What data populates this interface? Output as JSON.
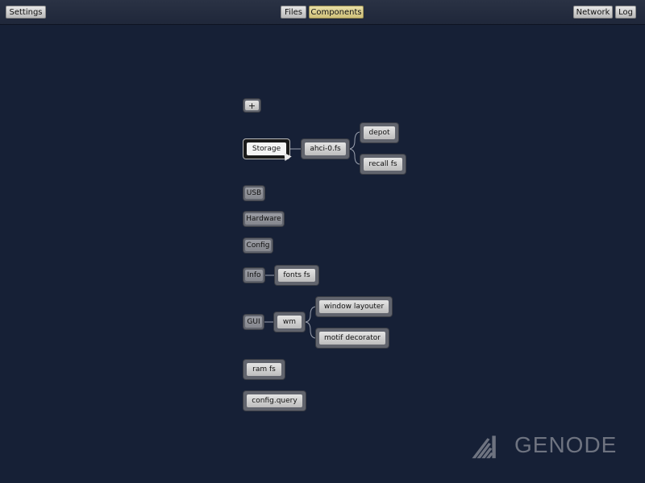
{
  "topbar": {
    "settings": "Settings",
    "files": "Files",
    "components": "Components",
    "network": "Network",
    "log": "Log",
    "active_tab": "Components"
  },
  "graph": {
    "add": "+",
    "storage": "Storage",
    "ahci": "ahci-0.fs",
    "depot": "depot",
    "recall": "recall fs",
    "usb": "USB",
    "hardware": "Hardware",
    "config": "Config",
    "info": "Info",
    "fonts": "fonts fs",
    "gui": "GUI",
    "wm": "wm",
    "window_layouter": "window layouter",
    "motif_decorator": "motif decorator",
    "ram_fs": "ram fs",
    "config_query": "config.query"
  },
  "logo": {
    "text": "GENODE"
  },
  "colors": {
    "background": "#162036",
    "accent": "#cfc07a",
    "node": "#61646d"
  }
}
